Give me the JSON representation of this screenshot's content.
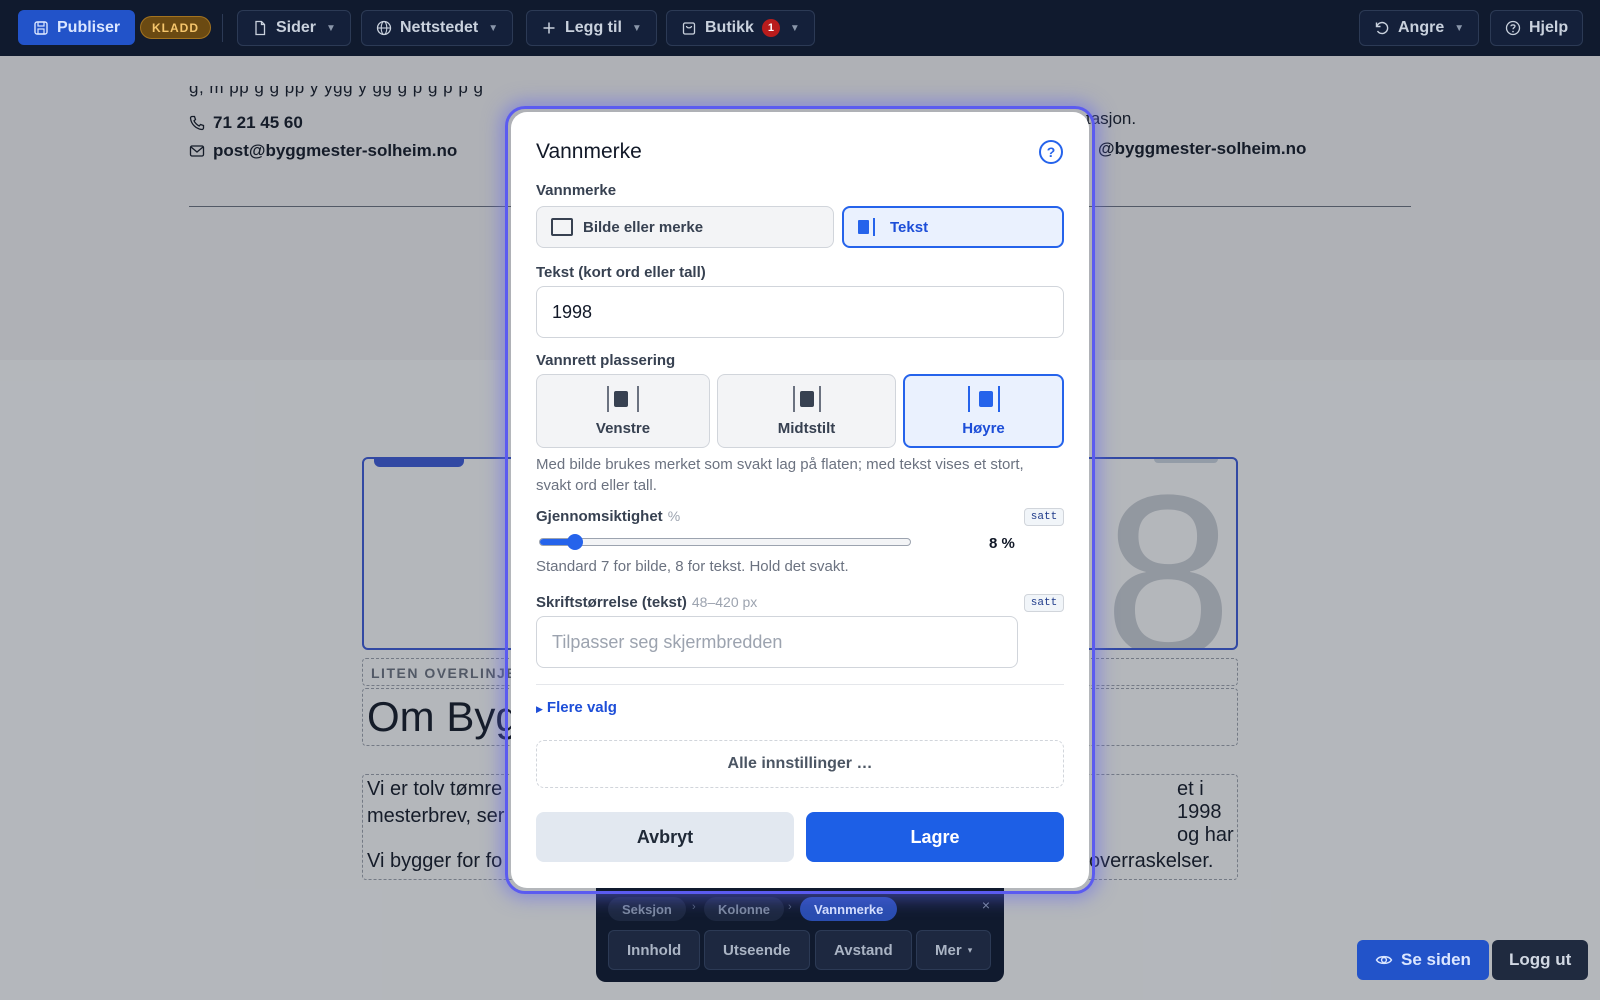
{
  "toolbar": {
    "publish_label": "Publiser",
    "draft_badge": "KLADD",
    "pages_label": "Sider",
    "website_label": "Nettstedet",
    "add_label": "Legg til",
    "shop_label": "Butikk",
    "shop_count": "1",
    "undo_label": "Angre",
    "help_label": "Hjelp"
  },
  "page": {
    "phone": "71 21 45 60",
    "email": "post@byggmester-solheim.no",
    "email_partial": "@byggmester-solheim.no",
    "partial_line": "tasjon.",
    "overline": "LITEN OVERLINJE",
    "heading_partial": "Om Bygg",
    "body_line1_left": "Vi er tolv tømre",
    "body_line1_right": "et i 1998 og har",
    "body_line2_left": "mesterbrev, ser",
    "body_line3_left": "Vi bygger for fo",
    "body_line3_right": "overraskelser.",
    "watermark_glyph": "8"
  },
  "modal": {
    "title": "Vannmerke",
    "help_icon": "?",
    "type_label": "Vannmerke",
    "type_options": [
      {
        "label": "Bilde eller merke",
        "selected": false
      },
      {
        "label": "Tekst",
        "selected": true
      }
    ],
    "text_label": "Tekst (kort ord eller tall)",
    "text_value": "1998",
    "position_label": "Vannrett plassering",
    "position_options": [
      {
        "label": "Venstre",
        "selected": false
      },
      {
        "label": "Midtstilt",
        "selected": false
      },
      {
        "label": "Høyre",
        "selected": true
      }
    ],
    "position_help_line1": "Med bilde brukes merket som svakt lag på flaten; med tekst vises et stort,",
    "position_help_line2": "svakt ord eller tall.",
    "opacity_label": "Gjennomsiktighet",
    "opacity_unit": "%",
    "opacity_badge": "satt",
    "opacity_value": 8,
    "opacity_max": 100,
    "opacity_display": "8 %",
    "opacity_help": "Standard 7 for bilde, 8 for tekst. Hold det svakt.",
    "size_label": "Skriftstørrelse (tekst)",
    "size_range": "48–420 px",
    "size_badge": "satt",
    "size_placeholder": "Tilpasser seg skjermbredden",
    "more_options": "Flere valg",
    "all_settings": "Alle innstillinger …",
    "cancel_label": "Avbryt",
    "save_label": "Lagre"
  },
  "breadcrumb": {
    "items": [
      "Seksjon",
      "Kolonne",
      "Vannmerke"
    ],
    "close": "×",
    "tabs": [
      "Innhold",
      "Utseende",
      "Avstand",
      "Mer"
    ],
    "more_chevron": "▾"
  },
  "footer": {
    "view_label": "Se siden",
    "logout_label": "Logg ut"
  },
  "colors": {
    "accent": "#2563eb",
    "toolbar_bg": "#101a2e",
    "draft_badge": "#f5c56b"
  }
}
